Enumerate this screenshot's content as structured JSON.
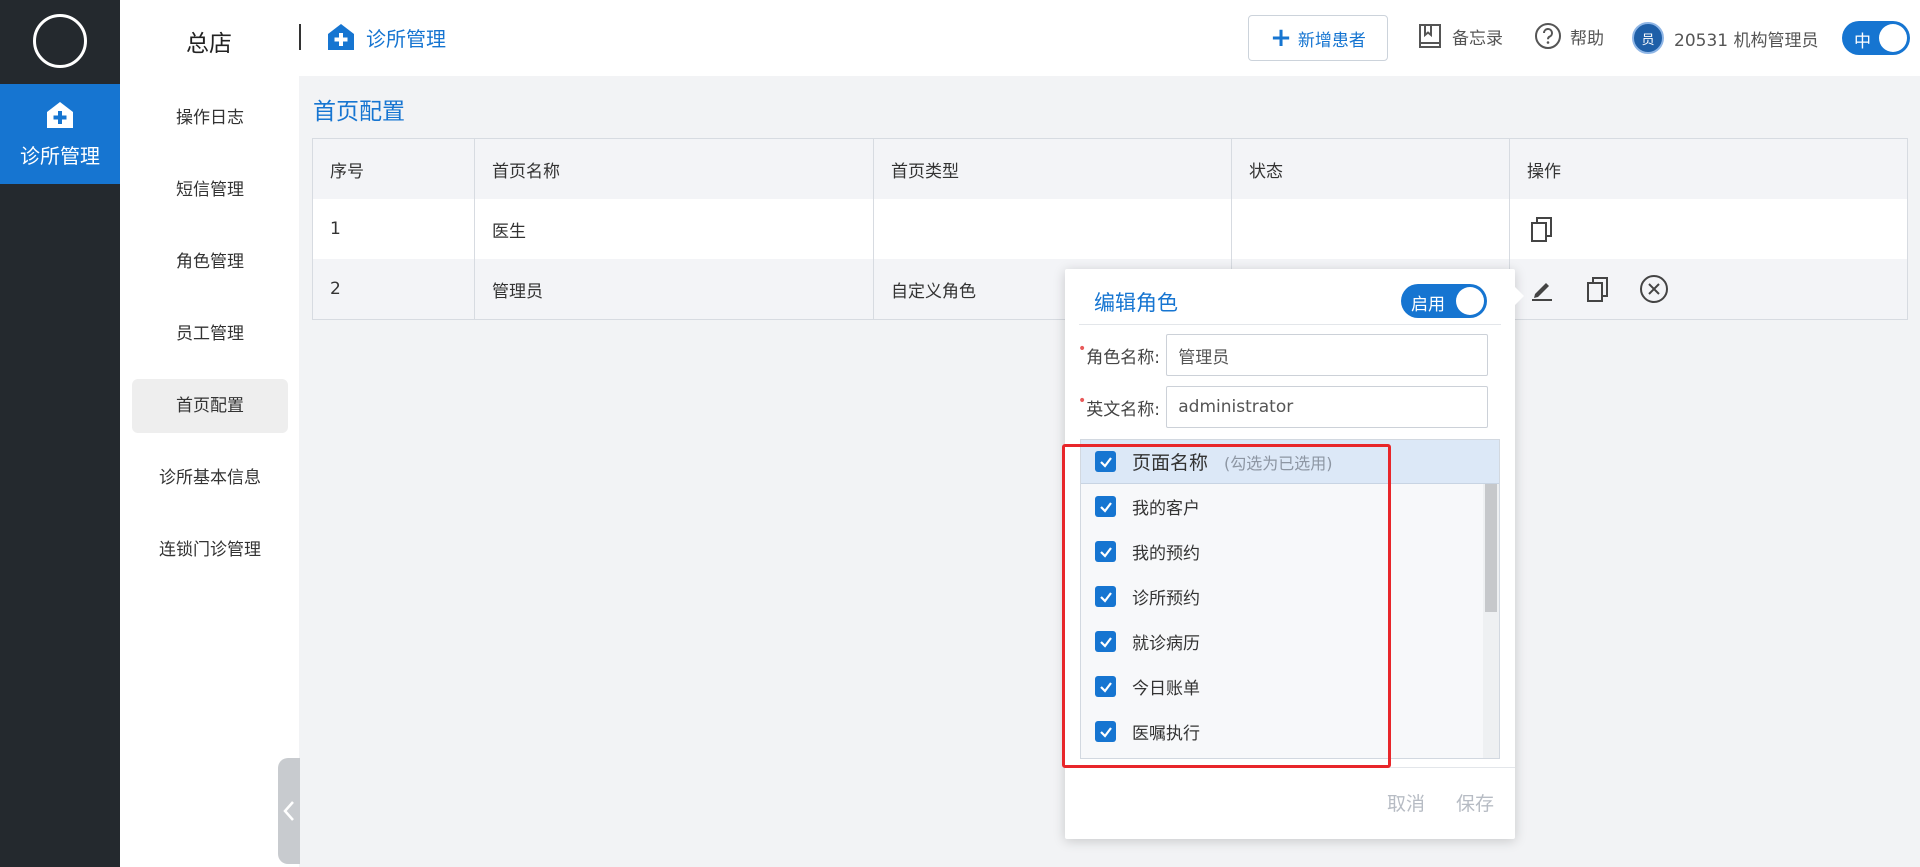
{
  "rail": {
    "active_label": "诊所管理"
  },
  "topbar": {
    "store": "总店",
    "breadcrumb": "诊所管理",
    "new_patient": "新增患者",
    "memo": "备忘录",
    "help": "帮助",
    "user_badge": "员",
    "user_name": "20531 机构管理员",
    "lang": "中"
  },
  "subnav": {
    "items": [
      {
        "label": "操作日志"
      },
      {
        "label": "短信管理"
      },
      {
        "label": "角色管理"
      },
      {
        "label": "员工管理"
      },
      {
        "label": "首页配置"
      },
      {
        "label": "诊所基本信息"
      },
      {
        "label": "连锁门诊管理"
      }
    ],
    "selected": "首页配置"
  },
  "main": {
    "title": "首页配置",
    "columns": [
      "序号",
      "首页名称",
      "首页类型",
      "状态",
      "操作"
    ],
    "rows": [
      {
        "no": "1",
        "name": "医生",
        "type": "",
        "status": ""
      },
      {
        "no": "2",
        "name": "管理员",
        "type": "自定义角色",
        "status": ""
      }
    ]
  },
  "dialog": {
    "title": "编辑角色",
    "toggle": "启用",
    "role_name_label": "角色名称:",
    "role_name_value": "管理员",
    "en_name_label": "英文名称:",
    "en_name_value": "administrator",
    "list_header": "页面名称",
    "list_hint": "(勾选为已选用)",
    "pages": [
      {
        "label": "我的客户",
        "checked": true
      },
      {
        "label": "我的预约",
        "checked": true
      },
      {
        "label": "诊所预约",
        "checked": true
      },
      {
        "label": "就诊病历",
        "checked": true
      },
      {
        "label": "今日账单",
        "checked": true
      },
      {
        "label": "医嘱执行",
        "checked": true
      }
    ],
    "cancel": "取消",
    "save": "保存"
  },
  "colors": {
    "accent": "#1675d1",
    "rail": "#24292e",
    "highlight": "#e8262a"
  }
}
